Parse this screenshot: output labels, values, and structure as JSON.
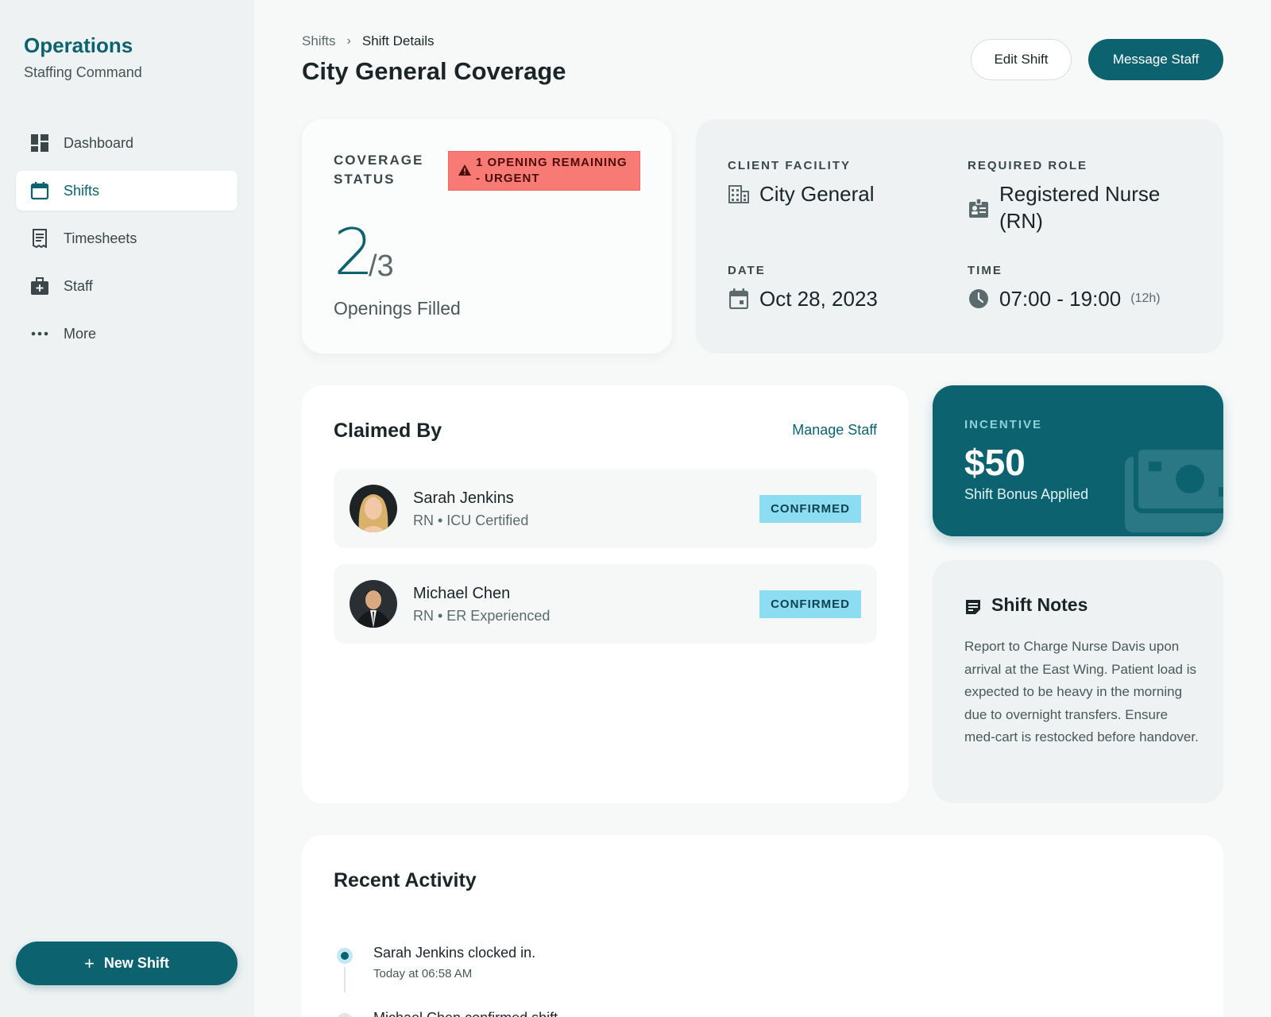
{
  "sidebar": {
    "brand_title": "Operations",
    "brand_subtitle": "Staffing Command",
    "items": [
      {
        "label": "Dashboard",
        "icon": "dashboard-icon"
      },
      {
        "label": "Shifts",
        "icon": "calendar-icon",
        "active": true
      },
      {
        "label": "Timesheets",
        "icon": "receipt-icon"
      },
      {
        "label": "Staff",
        "icon": "medical-bag-icon"
      },
      {
        "label": "More",
        "icon": "more-dots-icon"
      }
    ],
    "new_shift_label": "New Shift"
  },
  "header": {
    "breadcrumb": [
      "Shifts",
      "Shift Details"
    ],
    "title": "City General Coverage",
    "edit_label": "Edit Shift",
    "message_label": "Message Staff"
  },
  "coverage": {
    "label": "COVERAGE STATUS",
    "alert": "1 OPENING REMAINING - URGENT",
    "filled": "2",
    "total": "/3",
    "caption": "Openings Filled"
  },
  "details": {
    "facility_label": "CLIENT FACILITY",
    "facility_value": "City General",
    "role_label": "REQUIRED ROLE",
    "role_value": "Registered Nurse (RN)",
    "date_label": "DATE",
    "date_value": "Oct 28, 2023",
    "time_label": "TIME",
    "time_value": "07:00 - 19:00",
    "duration": "(12h)"
  },
  "claimed": {
    "title": "Claimed By",
    "manage_label": "Manage Staff",
    "staff": [
      {
        "name": "Sarah Jenkins",
        "subtitle": "RN • ICU Certified",
        "status": "CONFIRMED"
      },
      {
        "name": "Michael Chen",
        "subtitle": "RN • ER Experienced",
        "status": "CONFIRMED"
      }
    ]
  },
  "incentive": {
    "label": "INCENTIVE",
    "value": "$50",
    "subtitle": "Shift Bonus Applied"
  },
  "notes": {
    "title": "Shift Notes",
    "text": "Report to Charge Nurse Davis upon arrival at the East Wing. Patient load is expected to be heavy in the morning due to overnight transfers. Ensure med-cart is restocked before handover."
  },
  "activity": {
    "title": "Recent Activity",
    "items": [
      {
        "actor": "Sarah Jenkins",
        "action": "clocked in.",
        "time": "Today at 06:58 AM"
      },
      {
        "actor": "Michael Chen",
        "action": "confirmed shift.",
        "time": ""
      }
    ]
  },
  "colors": {
    "primary": "#0d6270",
    "urgent": "#f87a74",
    "confirmed_badge": "#8cdcf2"
  }
}
